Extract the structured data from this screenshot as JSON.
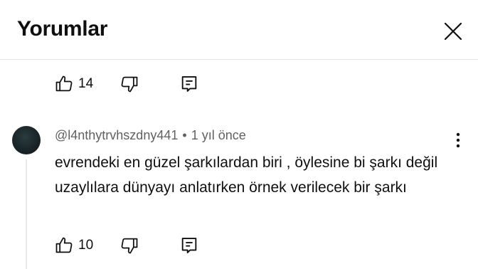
{
  "header": {
    "title": "Yorumlar"
  },
  "comments": [
    {
      "likes": "14"
    },
    {
      "author": "@l4nthytrvhszdny441",
      "separator": "•",
      "time": "1 yıl önce",
      "text": "evrendeki en güzel şarkılardan biri , öylesine bi şarkı değil uzaylılara dünyayı anlatırken örnek verilecek bir şarkı",
      "likes": "10"
    }
  ],
  "icons": {
    "close": "close-icon",
    "like": "thumbs-up-icon",
    "dislike": "thumbs-down-icon",
    "reply": "reply-comment-icon",
    "more": "more-vertical-icon"
  },
  "colors": {
    "text": "#0f0f0f",
    "secondary_text": "#606060",
    "divider": "#e5e5e5"
  }
}
